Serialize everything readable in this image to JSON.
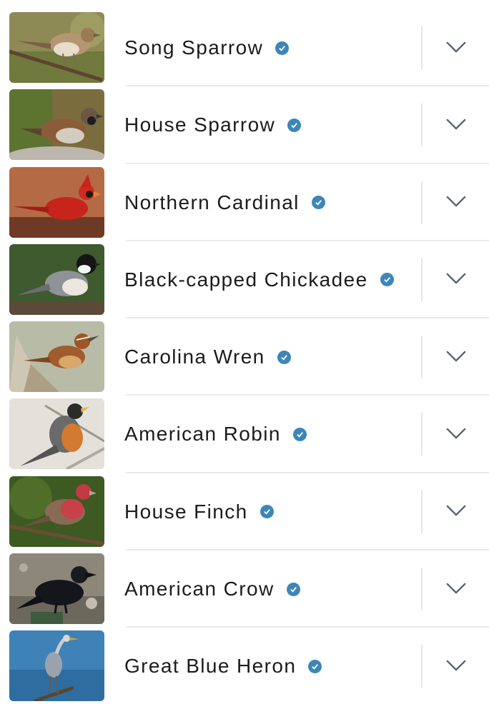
{
  "species_list": [
    {
      "name": "Song Sparrow",
      "photo": "song-sparrow"
    },
    {
      "name": "House Sparrow",
      "photo": "house-sparrow"
    },
    {
      "name": "Northern Cardinal",
      "photo": "northern-cardinal"
    },
    {
      "name": "Black-capped Chickadee",
      "photo": "black-capped-chickadee"
    },
    {
      "name": "Carolina Wren",
      "photo": "carolina-wren"
    },
    {
      "name": "American Robin",
      "photo": "american-robin"
    },
    {
      "name": "House Finch",
      "photo": "house-finch"
    },
    {
      "name": "American Crow",
      "photo": "american-crow"
    },
    {
      "name": "Great Blue Heron",
      "photo": "great-blue-heron"
    }
  ],
  "icons": {
    "verified": "verified-check-icon",
    "expand": "chevron-down-icon"
  },
  "colors": {
    "verified_badge": "#3d86b8",
    "chevron": "#5a6672",
    "text": "#1c1c1c",
    "divider": "#ebebeb"
  }
}
